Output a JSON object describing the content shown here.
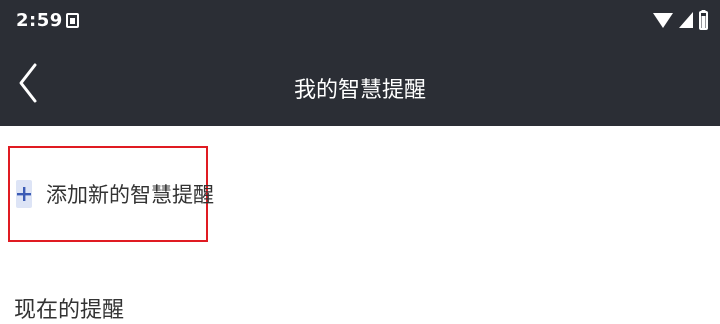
{
  "status_bar": {
    "time": "2:59",
    "icons": [
      "notification-icon",
      "wifi-icon",
      "signal-icon",
      "battery-icon"
    ]
  },
  "app_bar": {
    "title": "我的智慧提醒",
    "back_icon": "chevron-left-icon"
  },
  "add_reminder": {
    "icon": "plus-icon",
    "label": "添加新的智慧提醒"
  },
  "current_section": {
    "title": "现在的提醒"
  },
  "colors": {
    "header_bg": "#2b2e35",
    "highlight_border": "#e01b22",
    "plus_bg": "#dde4f6",
    "plus_fg": "#3b5bb5"
  }
}
